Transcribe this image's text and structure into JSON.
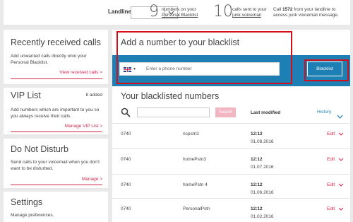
{
  "topbar": {
    "landline_label": "Landline",
    "blacklist_count": "9",
    "blacklist_desc_line1": "numbers on your",
    "blacklist_desc_line2": "Personal Blacklist",
    "junk_count": "10",
    "junk_desc_line1": "calls sent to your",
    "junk_desc_line2": "junk voicemail",
    "call_prefix": "Call",
    "call_number": "1572",
    "call_line1_suffix": "from your landline to",
    "call_line2": "access junk voicemail message."
  },
  "sidebar": {
    "recent": {
      "title": "Recently received calls",
      "text": "Add unwanted calls directly onto your Personal Blacklist.",
      "link": "View received calls >"
    },
    "vip": {
      "title": "VIP List",
      "badge": "8 added",
      "text": "Add numbers which are important to you so you always receive their calls.",
      "link": "Manage VIP List >"
    },
    "dnd": {
      "title": "Do Not Disturb",
      "text": "Send calls to your voicemail when you don't want to be disturbed.",
      "link": "Manage >"
    },
    "settings": {
      "title": "Settings",
      "text": "Manage preferences."
    }
  },
  "add_section": {
    "title": "Add a number to your blacklist",
    "flag_icon": "uk-flag-icon",
    "caret": "▾",
    "placeholder": "Enter a phone number",
    "button_label": "Blacklist"
  },
  "blacklisted": {
    "title": "Your blacklisted numbers",
    "search_button": "Search",
    "column_last_modified": "Last modified",
    "history_label": "History",
    "rows": [
      {
        "number": "0740",
        "name": "ncpstn3",
        "date": "01.08.2016",
        "time": "12:12",
        "action": "Edit"
      },
      {
        "number": "0740",
        "name": "homePstn3",
        "date": "01.07.2016",
        "time": "12:12",
        "action": "Edit"
      },
      {
        "number": "0740",
        "name": "homePstn 4",
        "date": "01.06.2016",
        "time": "12:12",
        "action": "Edit"
      },
      {
        "number": "0740",
        "name": "PersonalPstn",
        "date": "01.02.2016",
        "time": "12:12",
        "action": "Edit"
      }
    ]
  },
  "colors": {
    "accent_red": "#d6254a",
    "brand_blue": "#1d7fb4",
    "highlight_box": "#d40f1a"
  }
}
